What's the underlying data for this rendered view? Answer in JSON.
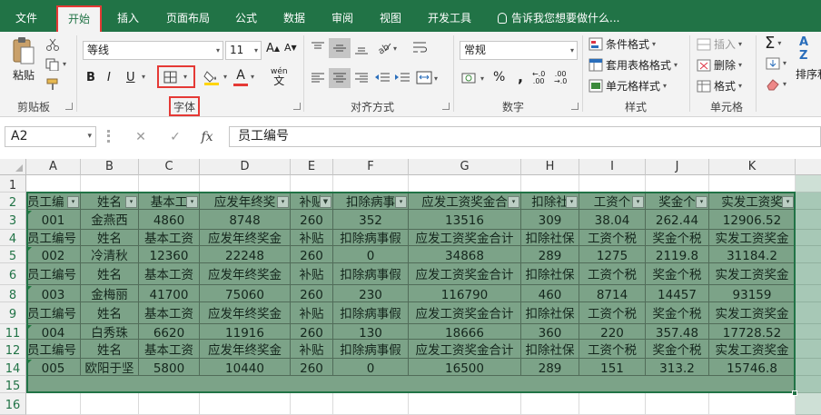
{
  "tabs": [
    {
      "label": "文件",
      "active": false
    },
    {
      "label": "开始",
      "active": true
    },
    {
      "label": "插入",
      "active": false
    },
    {
      "label": "页面布局",
      "active": false
    },
    {
      "label": "公式",
      "active": false
    },
    {
      "label": "数据",
      "active": false
    },
    {
      "label": "审阅",
      "active": false
    },
    {
      "label": "视图",
      "active": false
    },
    {
      "label": "开发工具",
      "active": false
    }
  ],
  "tell_me": "告诉我您想要做什么...",
  "ribbon": {
    "clipboard": {
      "paste": "粘贴",
      "group": "剪贴板"
    },
    "font": {
      "name": "等线",
      "size": "11",
      "bold": "B",
      "italic": "I",
      "underline": "U",
      "wen": "wén",
      "group": "字体"
    },
    "alignment": {
      "group": "对齐方式"
    },
    "number": {
      "format": "常规",
      "percent": "%",
      "comma": ",",
      "group": "数字"
    },
    "styles": {
      "conditional": "条件格式",
      "table": "套用表格格式",
      "cell": "单元格样式",
      "group": "样式"
    },
    "cells": {
      "insert": "插入",
      "delete": "删除",
      "format": "格式",
      "group": "单元格"
    },
    "editing": {
      "sort": "排序和"
    }
  },
  "formula_bar": {
    "name_box": "A2",
    "fx": "fx",
    "value": "员工编号"
  },
  "columns": [
    "A",
    "B",
    "C",
    "D",
    "E",
    "F",
    "G",
    "H",
    "I",
    "J",
    "K"
  ],
  "rows": [
    "1",
    "2",
    "3",
    "4",
    "5",
    "6",
    "8",
    "9",
    "11",
    "12",
    "14",
    "15",
    "16"
  ],
  "header_row_filtered": [
    "员工编",
    "姓名",
    "基本工",
    "应发年终奖",
    "补贴",
    "扣除病事",
    "应发工资奖金合",
    "扣除社",
    "工资个",
    "奖金个",
    "实发工资奖"
  ],
  "header_row": [
    "员工编号",
    "姓名",
    "基本工资",
    "应发年终奖金",
    "补贴",
    "扣除病事假",
    "应发工资奖金合计",
    "扣除社保",
    "工资个税",
    "奖金个税",
    "实发工资奖金"
  ],
  "records": [
    [
      "001",
      "金燕西",
      "4860",
      "8748",
      "260",
      "352",
      "13516",
      "309",
      "38.04",
      "262.44",
      "12906.52"
    ],
    [
      "002",
      "冷清秋",
      "12360",
      "22248",
      "260",
      "0",
      "34868",
      "289",
      "1275",
      "2119.8",
      "31184.2"
    ],
    [
      "003",
      "金梅丽",
      "41700",
      "75060",
      "260",
      "230",
      "116790",
      "460",
      "8714",
      "14457",
      "93159"
    ],
    [
      "004",
      "白秀珠",
      "6620",
      "11916",
      "260",
      "130",
      "18666",
      "360",
      "220",
      "357.48",
      "17728.52"
    ],
    [
      "005",
      "欧阳于坚",
      "5800",
      "10440",
      "260",
      "0",
      "16500",
      "289",
      "151",
      "313.2",
      "15746.8"
    ]
  ],
  "colors": {
    "ribbon_green": "#217346",
    "highlight_red": "#e53935",
    "data_fill": "#96b19c",
    "font_color_red": "#e53935",
    "fill_yellow": "#ffd400"
  }
}
